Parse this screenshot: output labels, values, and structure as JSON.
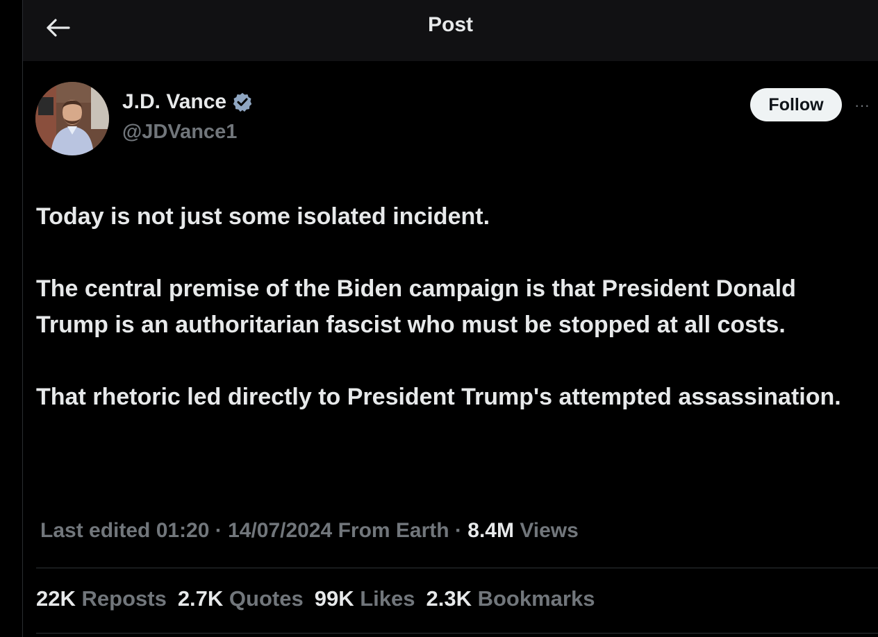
{
  "header": {
    "title": "Post"
  },
  "author": {
    "name": "J.D. Vance",
    "handle": "@JDVance1",
    "verified": true
  },
  "follow_label": "Follow",
  "more_label": "···",
  "tweet": {
    "paragraphs": [
      "Today is not just some isolated incident.",
      "The central premise of the Biden campaign is that President Donald Trump is an authoritarian fascist who must be stopped at all costs.",
      "That rhetoric led directly to President Trump's attempted assassination."
    ]
  },
  "meta": {
    "edited": "Last edited 01:20 · 14/07/2024",
    "location": "From Earth",
    "dot": " · ",
    "views_count": "8.4M",
    "views_label": " Views"
  },
  "stats": [
    {
      "count": "22K",
      "label": "Reposts"
    },
    {
      "count": "2.7K",
      "label": "Quotes"
    },
    {
      "count": "99K",
      "label": "Likes"
    },
    {
      "count": "2.3K",
      "label": "Bookmarks"
    }
  ],
  "colors": {
    "background": "#000000",
    "topbar": "#111113",
    "text_primary": "#e7e9ea",
    "text_secondary": "#71767b",
    "verified_badge": "#8fa6c2",
    "follow_bg": "#eff3f4"
  }
}
